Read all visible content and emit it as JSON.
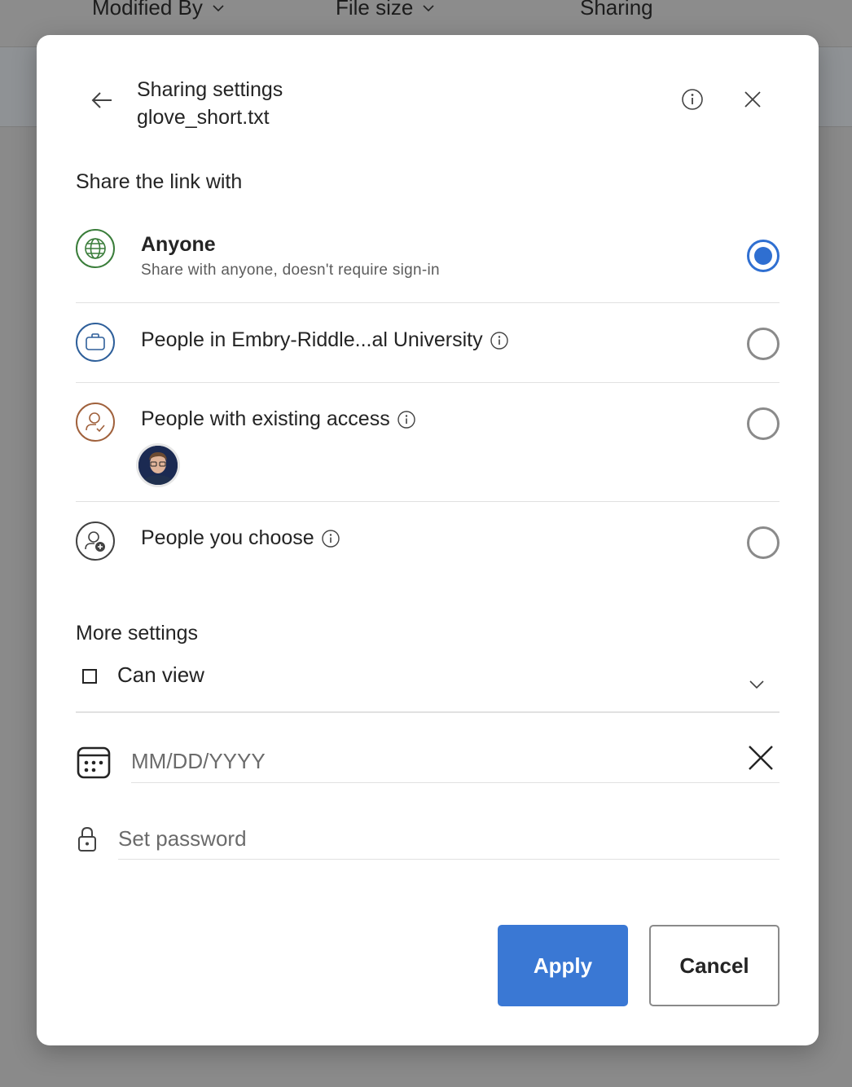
{
  "background": {
    "columns": [
      {
        "label": "Modified By",
        "icon": "chevron-down-icon"
      },
      {
        "label": "File size",
        "icon": "chevron-down-icon"
      },
      {
        "label": "Sharing"
      }
    ]
  },
  "dialog": {
    "title": "Sharing settings",
    "filename": "glove_short.txt",
    "share_label": "Share the link with",
    "options": [
      {
        "title": "Anyone",
        "subtitle": "Share with anyone, doesn't require sign-in",
        "icon": "globe-icon",
        "selected": true
      },
      {
        "title": "People in Embry-Riddle...al University",
        "icon": "briefcase-icon",
        "selected": false
      },
      {
        "title": "People with existing access",
        "icon": "person-check-icon",
        "selected": false
      },
      {
        "title": "People you choose",
        "icon": "person-add-icon",
        "selected": false
      }
    ],
    "more_settings_label": "More settings",
    "permission": "Can view",
    "date_placeholder": "MM/DD/YYYY",
    "password_placeholder": "Set password",
    "apply_label": "Apply",
    "cancel_label": "Cancel"
  },
  "colors": {
    "accent": "#3a78d4",
    "globe": "#3a7d3a",
    "briefcase": "#2e5f9a",
    "person": "#a0613c"
  }
}
